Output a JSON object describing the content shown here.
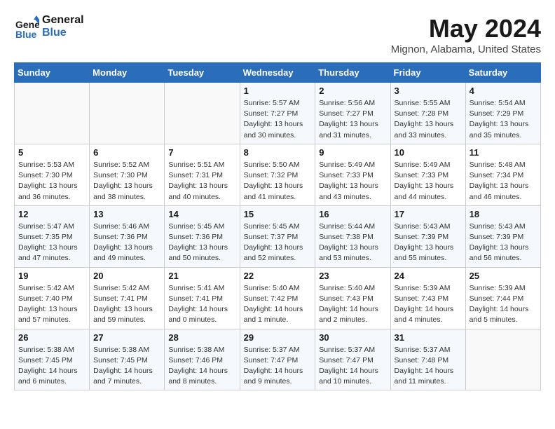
{
  "header": {
    "logo_line1": "General",
    "logo_line2": "Blue",
    "month": "May 2024",
    "location": "Mignon, Alabama, United States"
  },
  "weekdays": [
    "Sunday",
    "Monday",
    "Tuesday",
    "Wednesday",
    "Thursday",
    "Friday",
    "Saturday"
  ],
  "weeks": [
    [
      {
        "day": "",
        "sunrise": "",
        "sunset": "",
        "daylight": ""
      },
      {
        "day": "",
        "sunrise": "",
        "sunset": "",
        "daylight": ""
      },
      {
        "day": "",
        "sunrise": "",
        "sunset": "",
        "daylight": ""
      },
      {
        "day": "1",
        "sunrise": "5:57 AM",
        "sunset": "7:27 PM",
        "daylight": "13 hours and 30 minutes."
      },
      {
        "day": "2",
        "sunrise": "5:56 AM",
        "sunset": "7:27 PM",
        "daylight": "13 hours and 31 minutes."
      },
      {
        "day": "3",
        "sunrise": "5:55 AM",
        "sunset": "7:28 PM",
        "daylight": "13 hours and 33 minutes."
      },
      {
        "day": "4",
        "sunrise": "5:54 AM",
        "sunset": "7:29 PM",
        "daylight": "13 hours and 35 minutes."
      }
    ],
    [
      {
        "day": "5",
        "sunrise": "5:53 AM",
        "sunset": "7:30 PM",
        "daylight": "13 hours and 36 minutes."
      },
      {
        "day": "6",
        "sunrise": "5:52 AM",
        "sunset": "7:30 PM",
        "daylight": "13 hours and 38 minutes."
      },
      {
        "day": "7",
        "sunrise": "5:51 AM",
        "sunset": "7:31 PM",
        "daylight": "13 hours and 40 minutes."
      },
      {
        "day": "8",
        "sunrise": "5:50 AM",
        "sunset": "7:32 PM",
        "daylight": "13 hours and 41 minutes."
      },
      {
        "day": "9",
        "sunrise": "5:49 AM",
        "sunset": "7:33 PM",
        "daylight": "13 hours and 43 minutes."
      },
      {
        "day": "10",
        "sunrise": "5:49 AM",
        "sunset": "7:33 PM",
        "daylight": "13 hours and 44 minutes."
      },
      {
        "day": "11",
        "sunrise": "5:48 AM",
        "sunset": "7:34 PM",
        "daylight": "13 hours and 46 minutes."
      }
    ],
    [
      {
        "day": "12",
        "sunrise": "5:47 AM",
        "sunset": "7:35 PM",
        "daylight": "13 hours and 47 minutes."
      },
      {
        "day": "13",
        "sunrise": "5:46 AM",
        "sunset": "7:36 PM",
        "daylight": "13 hours and 49 minutes."
      },
      {
        "day": "14",
        "sunrise": "5:45 AM",
        "sunset": "7:36 PM",
        "daylight": "13 hours and 50 minutes."
      },
      {
        "day": "15",
        "sunrise": "5:45 AM",
        "sunset": "7:37 PM",
        "daylight": "13 hours and 52 minutes."
      },
      {
        "day": "16",
        "sunrise": "5:44 AM",
        "sunset": "7:38 PM",
        "daylight": "13 hours and 53 minutes."
      },
      {
        "day": "17",
        "sunrise": "5:43 AM",
        "sunset": "7:39 PM",
        "daylight": "13 hours and 55 minutes."
      },
      {
        "day": "18",
        "sunrise": "5:43 AM",
        "sunset": "7:39 PM",
        "daylight": "13 hours and 56 minutes."
      }
    ],
    [
      {
        "day": "19",
        "sunrise": "5:42 AM",
        "sunset": "7:40 PM",
        "daylight": "13 hours and 57 minutes."
      },
      {
        "day": "20",
        "sunrise": "5:42 AM",
        "sunset": "7:41 PM",
        "daylight": "13 hours and 59 minutes."
      },
      {
        "day": "21",
        "sunrise": "5:41 AM",
        "sunset": "7:41 PM",
        "daylight": "14 hours and 0 minutes."
      },
      {
        "day": "22",
        "sunrise": "5:40 AM",
        "sunset": "7:42 PM",
        "daylight": "14 hours and 1 minute."
      },
      {
        "day": "23",
        "sunrise": "5:40 AM",
        "sunset": "7:43 PM",
        "daylight": "14 hours and 2 minutes."
      },
      {
        "day": "24",
        "sunrise": "5:39 AM",
        "sunset": "7:43 PM",
        "daylight": "14 hours and 4 minutes."
      },
      {
        "day": "25",
        "sunrise": "5:39 AM",
        "sunset": "7:44 PM",
        "daylight": "14 hours and 5 minutes."
      }
    ],
    [
      {
        "day": "26",
        "sunrise": "5:38 AM",
        "sunset": "7:45 PM",
        "daylight": "14 hours and 6 minutes."
      },
      {
        "day": "27",
        "sunrise": "5:38 AM",
        "sunset": "7:45 PM",
        "daylight": "14 hours and 7 minutes."
      },
      {
        "day": "28",
        "sunrise": "5:38 AM",
        "sunset": "7:46 PM",
        "daylight": "14 hours and 8 minutes."
      },
      {
        "day": "29",
        "sunrise": "5:37 AM",
        "sunset": "7:47 PM",
        "daylight": "14 hours and 9 minutes."
      },
      {
        "day": "30",
        "sunrise": "5:37 AM",
        "sunset": "7:47 PM",
        "daylight": "14 hours and 10 minutes."
      },
      {
        "day": "31",
        "sunrise": "5:37 AM",
        "sunset": "7:48 PM",
        "daylight": "14 hours and 11 minutes."
      },
      {
        "day": "",
        "sunrise": "",
        "sunset": "",
        "daylight": ""
      }
    ]
  ]
}
